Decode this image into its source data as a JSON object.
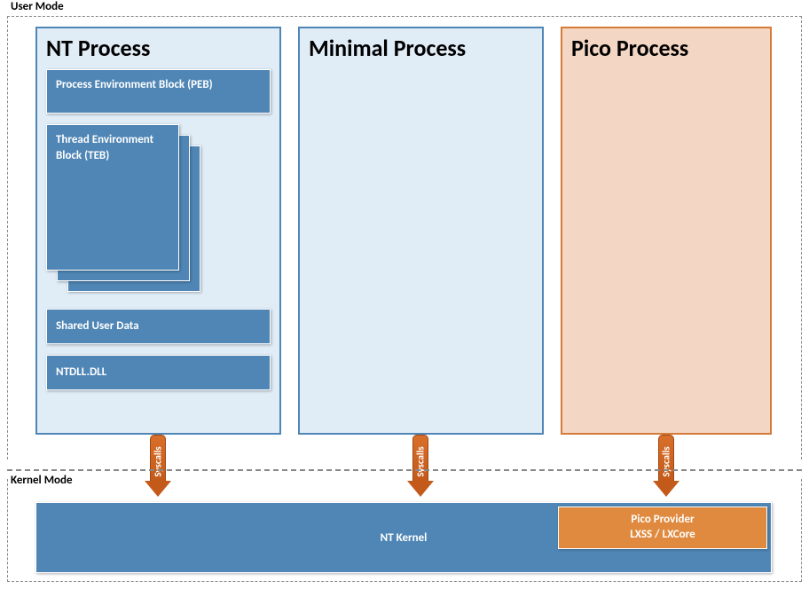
{
  "labels": {
    "user_mode": "User Mode",
    "kernel_mode": "Kernel Mode",
    "syscalls": "Syscalls"
  },
  "processes": {
    "nt": {
      "title": "NT Process",
      "peb": "Process Environment Block (PEB)",
      "teb": "Thread Environment Block (TEB)",
      "shared_user_data": "Shared User Data",
      "ntdll": "NTDLL.DLL"
    },
    "minimal": {
      "title": "Minimal Process"
    },
    "pico": {
      "title": "Pico Process"
    }
  },
  "kernel": {
    "nt_kernel": "NT Kernel",
    "pico_provider_line1": "Pico Provider",
    "pico_provider_line2": "LXSS / LXCore"
  }
}
